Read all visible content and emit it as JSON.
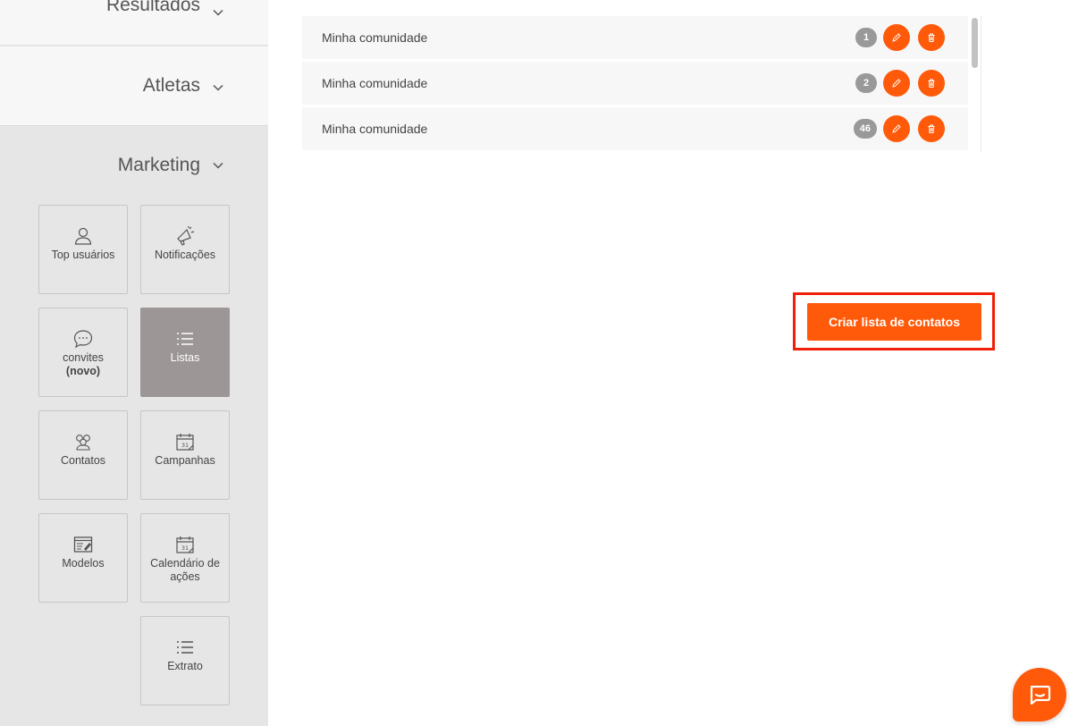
{
  "sidebar": {
    "sections": [
      {
        "label": "Resultados"
      },
      {
        "label": "Atletas"
      },
      {
        "label": "Marketing"
      }
    ],
    "tiles": [
      {
        "label": "Top usuários",
        "icon": "user-icon"
      },
      {
        "label": "Notificações",
        "icon": "megaphone-icon"
      },
      {
        "label": "convites",
        "sub": "(novo)",
        "icon": "chat-bubble-icon"
      },
      {
        "label": "Listas",
        "icon": "list-icon",
        "active": true
      },
      {
        "label": "Contatos",
        "icon": "group-icon"
      },
      {
        "label": "Campanhas",
        "icon": "calendar-icon"
      },
      {
        "label": "Modelos",
        "icon": "template-icon"
      },
      {
        "label": "Calendário de ações",
        "icon": "calendar-icon"
      },
      {
        "label": "Extrato",
        "icon": "list-icon"
      }
    ]
  },
  "lists": [
    {
      "name": "Minha comunidade",
      "count": "1"
    },
    {
      "name": "Minha comunidade",
      "count": "2"
    },
    {
      "name": "Minha comunidade",
      "count": "46"
    }
  ],
  "create_button": {
    "label": "Criar lista de contatos"
  },
  "colors": {
    "accent": "#ff5a0a",
    "active_tile": "#9d9696",
    "highlight_border": "#f02008",
    "badge": "#999999"
  }
}
